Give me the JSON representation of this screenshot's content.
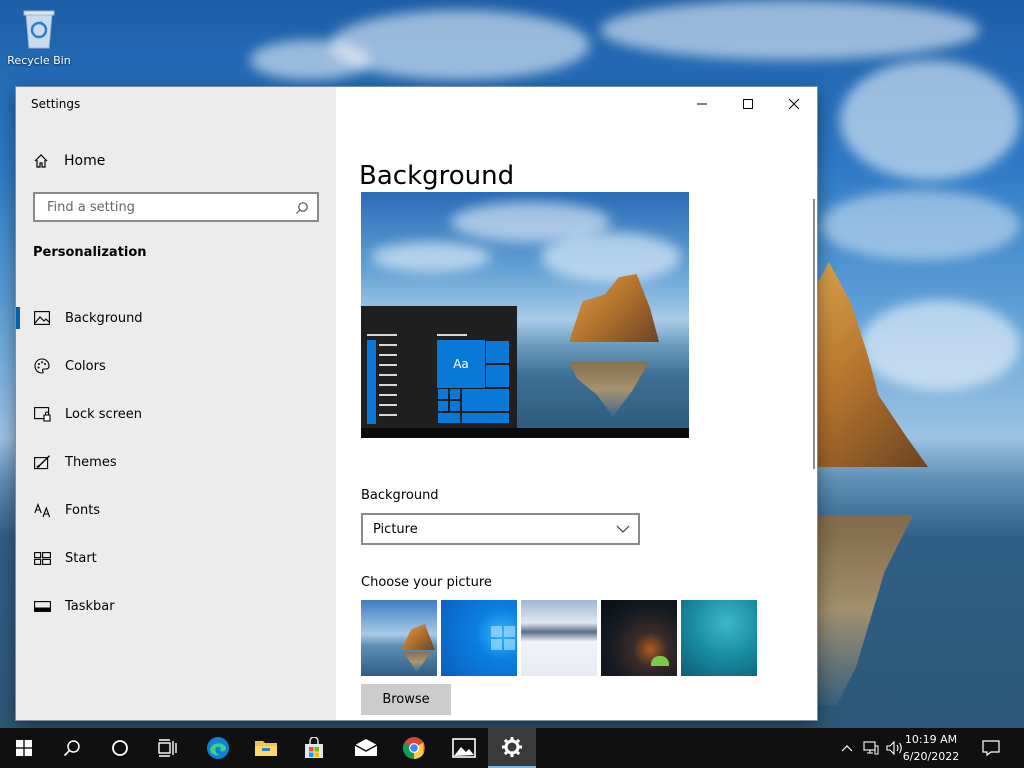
{
  "desktop": {
    "recycle_bin_label": "Recycle Bin"
  },
  "window": {
    "title": "Settings",
    "controls": [
      "minimize",
      "maximize",
      "close"
    ]
  },
  "sidebar": {
    "home_label": "Home",
    "search_placeholder": "Find a setting",
    "section_title": "Personalization",
    "items": [
      {
        "label": "Background",
        "icon": "image-icon",
        "active": true
      },
      {
        "label": "Colors",
        "icon": "palette-icon",
        "active": false
      },
      {
        "label": "Lock screen",
        "icon": "lock-screen-icon",
        "active": false
      },
      {
        "label": "Themes",
        "icon": "themes-icon",
        "active": false
      },
      {
        "label": "Fonts",
        "icon": "fonts-icon",
        "active": false
      },
      {
        "label": "Start",
        "icon": "start-icon",
        "active": false
      },
      {
        "label": "Taskbar",
        "icon": "taskbar-icon",
        "active": false
      }
    ]
  },
  "main": {
    "page_title": "Background",
    "preview_tile_text": "Aa",
    "background_label": "Background",
    "background_selected": "Picture",
    "choose_picture_label": "Choose your picture",
    "browse_label": "Browse",
    "thumbnails": [
      "beach-rock",
      "windows-blue",
      "snowy-mountain",
      "night-sky-tent",
      "underwater-swimmer"
    ]
  },
  "taskbar": {
    "apps": [
      "start",
      "search",
      "cortana",
      "task-view",
      "edge",
      "file-explorer",
      "store",
      "mail",
      "chrome",
      "photos",
      "settings"
    ],
    "active_app": "settings",
    "clock_time": "10:19 AM",
    "clock_date": "6/20/2022"
  },
  "colors": {
    "accent": "#0078d7",
    "sidebar_bg": "#ececec",
    "taskbar_bg": "#101010"
  }
}
